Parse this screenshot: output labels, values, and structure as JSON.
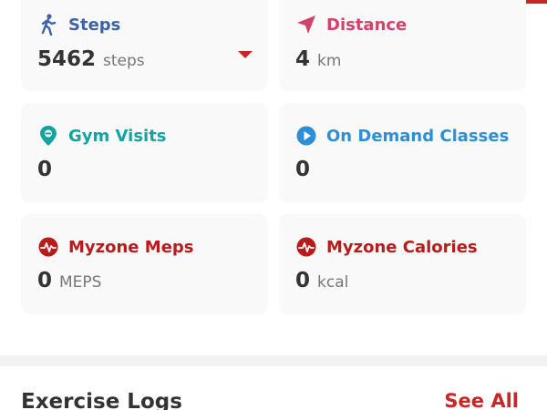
{
  "colors": {
    "steps": "#3f63a6",
    "distance": "#d0446b",
    "gym": "#14a3a0",
    "on_demand": "#2e8fd6",
    "myzone": "#b71c1c",
    "accent": "#c62828"
  },
  "cards": {
    "steps": {
      "title": "Steps",
      "value": "5462",
      "unit": "steps",
      "icon": "walking-person-icon"
    },
    "distance": {
      "title": "Distance",
      "value": "4",
      "unit": "km",
      "icon": "navigation-arrow-icon"
    },
    "gym": {
      "title": "Gym Visits",
      "value": "0",
      "unit": "",
      "icon": "location-pin-icon"
    },
    "on_demand": {
      "title": "On Demand Classes",
      "value": "0",
      "unit": "",
      "icon": "play-circle-icon"
    },
    "meps": {
      "title": "Myzone Meps",
      "value": "0",
      "unit": "MEPS",
      "icon": "myzone-heart-icon"
    },
    "calories": {
      "title": "Myzone Calories",
      "value": "0",
      "unit": "kcal",
      "icon": "myzone-heart-icon"
    }
  },
  "exercise_logs": {
    "title": "Exercise Logs",
    "see_all": "See All"
  }
}
